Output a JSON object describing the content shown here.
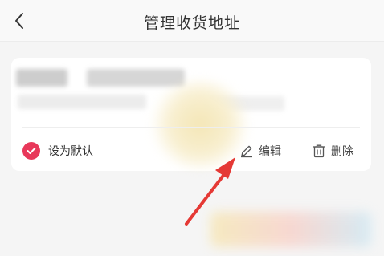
{
  "header": {
    "title": "管理收货地址",
    "back_icon": "chevron-left-icon"
  },
  "address_card": {
    "default_label": "设为默认",
    "edit_label": "编辑",
    "delete_label": "删除",
    "icons": {
      "default": "check-circle-icon",
      "edit": "pencil-icon",
      "delete": "trash-icon"
    }
  },
  "colors": {
    "accent": "#e8385a",
    "annotation_arrow": "#e53935",
    "background": "#f5f5f5",
    "card": "#ffffff"
  }
}
